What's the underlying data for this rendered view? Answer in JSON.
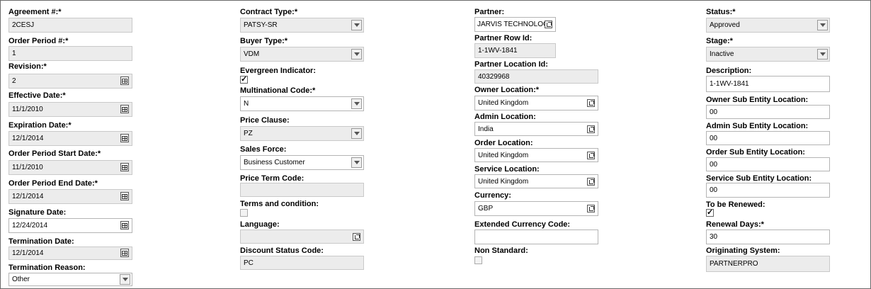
{
  "required_mark": "*",
  "col1": {
    "agreement": {
      "label": "Agreement #:",
      "value": "2CESJ"
    },
    "order_period": {
      "label": "Order Period #:",
      "value": "1"
    },
    "revision": {
      "label": "Revision:",
      "value": "2"
    },
    "effective_date": {
      "label": "Effective Date:",
      "value": "11/1/2010"
    },
    "expiration_date": {
      "label": "Expiration Date:",
      "value": "12/1/2014"
    },
    "op_start": {
      "label": "Order Period Start Date:",
      "value": "11/1/2010"
    },
    "op_end": {
      "label": "Order Period End Date:",
      "value": "12/1/2014"
    },
    "signature_date": {
      "label": "Signature Date:",
      "value": "12/24/2014"
    },
    "termination_date": {
      "label": "Termination Date:",
      "value": "12/1/2014"
    },
    "termination_reason": {
      "label": "Termination Reason:",
      "value": "Other"
    }
  },
  "col2": {
    "contract_type": {
      "label": "Contract Type:",
      "value": "PATSY-SR"
    },
    "buyer_type": {
      "label": "Buyer Type:",
      "value": "VDM"
    },
    "evergreen": {
      "label": "Evergreen Indicator:",
      "checked": true,
      "mark": "✓"
    },
    "multinational": {
      "label": "Multinational Code:",
      "value": "N"
    },
    "price_clause": {
      "label": "Price Clause:",
      "value": "PZ"
    },
    "sales_force": {
      "label": "Sales Force:",
      "value": "Business Customer"
    },
    "price_term": {
      "label": "Price Term Code:",
      "value": ""
    },
    "terms": {
      "label": "Terms and condition:",
      "checked": false
    },
    "language": {
      "label": "Language:",
      "value": ""
    },
    "discount": {
      "label": "Discount Status Code:",
      "value": "PC"
    }
  },
  "col3": {
    "partner": {
      "label": "Partner:",
      "value": "JARVIS TECHNOLOG"
    },
    "partner_row": {
      "label": "Partner Row Id:",
      "value": "1-1WV-1841"
    },
    "partner_loc": {
      "label": "Partner Location Id:",
      "value": "40329968"
    },
    "owner_loc": {
      "label": "Owner Location:",
      "value": "United Kingdom"
    },
    "admin_loc": {
      "label": "Admin Location:",
      "value": "India"
    },
    "order_loc": {
      "label": "Order Location:",
      "value": "United Kingdom"
    },
    "service_loc": {
      "label": "Service Location:",
      "value": "United Kingdom"
    },
    "currency": {
      "label": "Currency:",
      "value": "GBP"
    },
    "ext_currency": {
      "label": "Extended Currency Code:",
      "value": ""
    },
    "non_standard": {
      "label": "Non Standard:",
      "checked": false
    }
  },
  "col4": {
    "status": {
      "label": "Status:",
      "value": "Approved"
    },
    "stage": {
      "label": "Stage:",
      "value": "Inactive"
    },
    "description": {
      "label": "Description:",
      "value": "1-1WV-1841"
    },
    "owner_sub": {
      "label": "Owner Sub Entity Location:",
      "value": "00"
    },
    "admin_sub": {
      "label": "Admin Sub Entity Location:",
      "value": "00"
    },
    "order_sub": {
      "label": "Order Sub Entity Location:",
      "value": "00"
    },
    "service_sub": {
      "label": "Service Sub Entity Location:",
      "value": "00"
    },
    "to_renew": {
      "label": "To be Renewed:",
      "checked": true,
      "mark": "✓"
    },
    "renewal_days": {
      "label": "Renewal Days:",
      "value": "30"
    },
    "originating": {
      "label": "Originating System:",
      "value": "PARTNERPRO"
    }
  }
}
